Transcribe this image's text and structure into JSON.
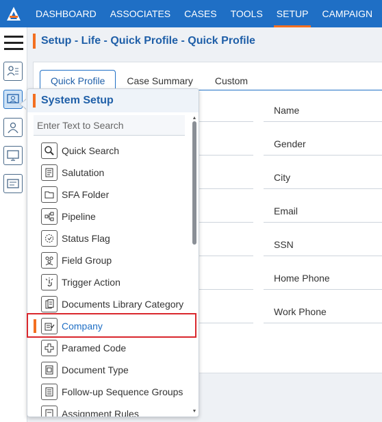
{
  "nav": {
    "items": [
      {
        "label": "DASHBOARD"
      },
      {
        "label": "ASSOCIATES"
      },
      {
        "label": "CASES"
      },
      {
        "label": "TOOLS"
      },
      {
        "label": "SETUP",
        "active": true
      },
      {
        "label": "CAMPAIGN"
      }
    ]
  },
  "breadcrumb": "Setup - Life - Quick Profile - Quick Profile",
  "tabs": [
    {
      "label": "Quick Profile",
      "active": true
    },
    {
      "label": "Case Summary"
    },
    {
      "label": "Custom"
    }
  ],
  "fields": [
    "Name",
    "Gender",
    "City",
    "Email",
    "SSN",
    "Home Phone",
    "Work Phone"
  ],
  "system_setup": {
    "title": "System Setup",
    "search_placeholder": "Enter Text to Search",
    "items": [
      {
        "label": "Quick Search",
        "icon": "search-icon"
      },
      {
        "label": "Salutation",
        "icon": "document-icon"
      },
      {
        "label": "SFA Folder",
        "icon": "folder-icon"
      },
      {
        "label": "Pipeline",
        "icon": "pipeline-icon"
      },
      {
        "label": "Status Flag",
        "icon": "status-flag-icon"
      },
      {
        "label": "Field Group",
        "icon": "group-icon"
      },
      {
        "label": "Trigger Action",
        "icon": "trigger-icon"
      },
      {
        "label": "Documents Library Category",
        "icon": "library-icon"
      },
      {
        "label": "Company",
        "icon": "company-icon",
        "selected": true
      },
      {
        "label": "Paramed Code",
        "icon": "paramed-icon"
      },
      {
        "label": "Document Type",
        "icon": "document-type-icon"
      },
      {
        "label": "Follow-up Sequence Groups",
        "icon": "followup-icon"
      },
      {
        "label": "Assignment Rules",
        "icon": "assignment-icon"
      }
    ]
  },
  "colors": {
    "nav_bg": "#1f6fc5",
    "accent": "#f36f21",
    "highlight": "#d9262c"
  }
}
